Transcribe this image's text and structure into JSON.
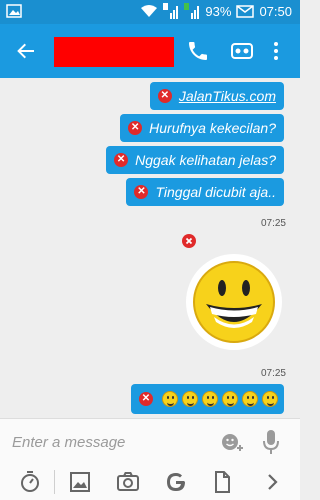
{
  "status_bar": {
    "battery_percent": "93%",
    "time": "07:50"
  },
  "header": {
    "contact_name": ""
  },
  "messages": [
    {
      "text": "JalanTikus.com",
      "is_link": true
    },
    {
      "text": "Hurufnya kekecilan?"
    },
    {
      "text": "Nggak kelihatan jelas?"
    },
    {
      "text": "Tinggal dicubit aja.."
    }
  ],
  "timestamps": {
    "first": "07:25",
    "second": "07:25"
  },
  "composer": {
    "placeholder": "Enter a message"
  },
  "colors": {
    "accent": "#1b9ae0",
    "error": "#e02a2a",
    "redaction": "#ff0000"
  }
}
